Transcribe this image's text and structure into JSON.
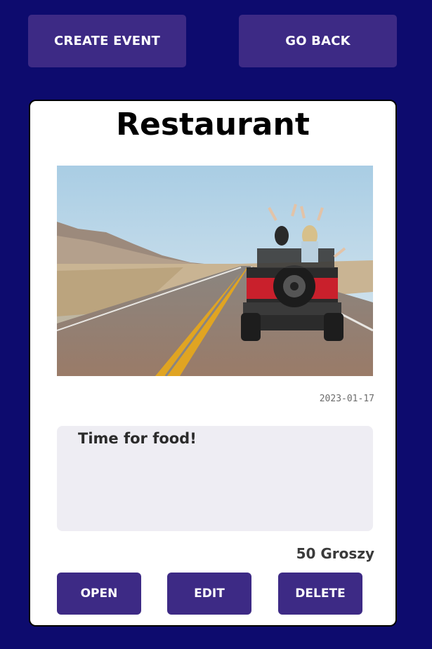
{
  "toolbar": {
    "create_label": "CREATE EVENT",
    "back_label": "GO BACK"
  },
  "event": {
    "title": "Restaurant",
    "date": "2023-01-17",
    "description": "Time for food!",
    "price": "50 Groszy"
  },
  "actions": {
    "open_label": "OPEN",
    "edit_label": "EDIT",
    "delete_label": "DELETE"
  },
  "colors": {
    "background": "#0d0b6e",
    "button": "#3d2a85",
    "card": "#ffffff",
    "description_box": "#eeedf3"
  }
}
